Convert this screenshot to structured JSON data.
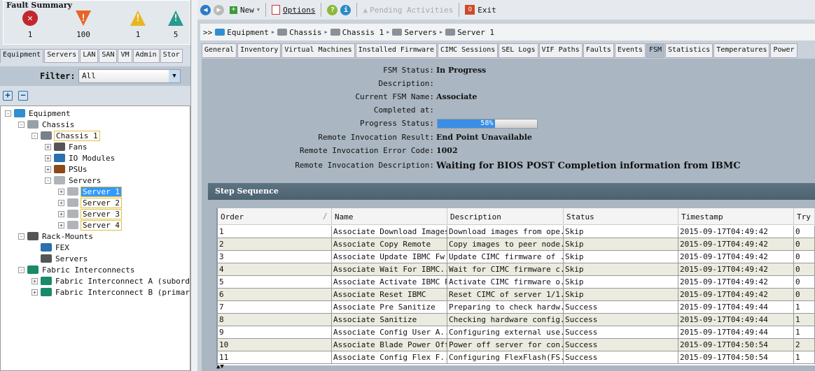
{
  "fault_summary": {
    "title": "Fault Summary",
    "items": [
      {
        "type": "critical",
        "count": "1",
        "color": "#c0282d"
      },
      {
        "type": "major",
        "count": "100",
        "color": "#e8652a"
      },
      {
        "type": "minor",
        "count": "1",
        "color": "#e8b620"
      },
      {
        "type": "warning",
        "count": "5",
        "color": "#2a9a8a"
      }
    ]
  },
  "left_tabs": [
    "Equipment",
    "Servers",
    "LAN",
    "SAN",
    "VM",
    "Admin",
    "Stor"
  ],
  "filter": {
    "label": "Filter:",
    "value": "All"
  },
  "tree": [
    {
      "label": "Equipment",
      "level": 0,
      "exp": "-",
      "icon": "#2f8fd0"
    },
    {
      "label": "Chassis",
      "level": 1,
      "exp": "-",
      "icon": "#9aa0a8"
    },
    {
      "label": "Chassis 1",
      "level": 2,
      "exp": "-",
      "icon": "#7a8088",
      "hl": true
    },
    {
      "label": "Fans",
      "level": 3,
      "exp": "+",
      "icon": "#555"
    },
    {
      "label": "IO Modules",
      "level": 3,
      "exp": "+",
      "icon": "#2a6fb0"
    },
    {
      "label": "PSUs",
      "level": 3,
      "exp": "+",
      "icon": "#8a4a1a"
    },
    {
      "label": "Servers",
      "level": 3,
      "exp": "-",
      "icon": "#b0b4b8"
    },
    {
      "label": "Server 1",
      "level": 4,
      "exp": "+",
      "icon": "#b0b4b8",
      "hl": true,
      "sel": true
    },
    {
      "label": "Server 2",
      "level": 4,
      "exp": "+",
      "icon": "#b0b4b8",
      "hl": true
    },
    {
      "label": "Server 3",
      "level": 4,
      "exp": "+",
      "icon": "#b0b4b8",
      "hl": true
    },
    {
      "label": "Server 4",
      "level": 4,
      "exp": "+",
      "icon": "#b0b4b8",
      "hl": true
    },
    {
      "label": "Rack-Mounts",
      "level": 1,
      "exp": "-",
      "icon": "#555"
    },
    {
      "label": "FEX",
      "level": 2,
      "exp": "",
      "icon": "#2a6fb0"
    },
    {
      "label": "Servers",
      "level": 2,
      "exp": "",
      "icon": "#555"
    },
    {
      "label": "Fabric Interconnects",
      "level": 1,
      "exp": "-",
      "icon": "#1a8a6a"
    },
    {
      "label": "Fabric Interconnect A (subordinate)",
      "level": 2,
      "exp": "+",
      "icon": "#1a8a6a"
    },
    {
      "label": "Fabric Interconnect B (primary)",
      "level": 2,
      "exp": "+",
      "icon": "#1a8a6a"
    }
  ],
  "toolbar": {
    "new": "New",
    "options": "Options",
    "pending": "Pending Activities",
    "exit": "Exit"
  },
  "breadcrumb": [
    "Equipment",
    "Chassis",
    "Chassis 1",
    "Servers",
    "Server 1"
  ],
  "tabs": [
    "General",
    "Inventory",
    "Virtual Machines",
    "Installed Firmware",
    "CIMC Sessions",
    "SEL Logs",
    "VIF Paths",
    "Faults",
    "Events",
    "FSM",
    "Statistics",
    "Temperatures",
    "Power"
  ],
  "active_tab": "FSM",
  "fsm": {
    "fields": [
      {
        "label": "FSM Status:",
        "value": "In Progress"
      },
      {
        "label": "Description:",
        "value": ""
      },
      {
        "label": "Current FSM Name:",
        "value": "Associate"
      },
      {
        "label": "Completed at:",
        "value": ""
      },
      {
        "label": "Progress Status:",
        "value": "58%"
      },
      {
        "label": "Remote Invocation Result:",
        "value": "End Point Unavailable"
      },
      {
        "label": "Remote Invocation Error Code:",
        "value": "1002"
      },
      {
        "label": "Remote Invocation Description:",
        "value": "Waiting for BIOS POST Completion information from IBMC"
      }
    ],
    "progress_percent": 58
  },
  "step_sequence": {
    "title": "Step Sequence",
    "columns": [
      "Order",
      "Name",
      "Description",
      "Status",
      "Timestamp",
      "Try"
    ],
    "rows": [
      [
        "1",
        "Associate Download Images",
        "Download images from ope...",
        "Skip",
        "2015-09-17T04:49:42",
        "0"
      ],
      [
        "2",
        "Associate Copy Remote",
        "Copy images to peer node...",
        "Skip",
        "2015-09-17T04:49:42",
        "0"
      ],
      [
        "3",
        "Associate Update IBMC Fw",
        "Update CIMC firmware of ...",
        "Skip",
        "2015-09-17T04:49:42",
        "0"
      ],
      [
        "4",
        "Associate Wait For IBMC...",
        "Wait for CIMC firmware c...",
        "Skip",
        "2015-09-17T04:49:42",
        "0"
      ],
      [
        "5",
        "Associate Activate IBMC Fw",
        "Activate CIMC firmware o...",
        "Skip",
        "2015-09-17T04:49:42",
        "0"
      ],
      [
        "6",
        "Associate Reset IBMC",
        "Reset CIMC of server 1/1...",
        "Skip",
        "2015-09-17T04:49:42",
        "0"
      ],
      [
        "7",
        "Associate Pre Sanitize",
        "Preparing to check hardw...",
        "Success",
        "2015-09-17T04:49:44",
        "1"
      ],
      [
        "8",
        "Associate Sanitize",
        "Checking hardware config...",
        "Success",
        "2015-09-17T04:49:44",
        "1"
      ],
      [
        "9",
        "Associate Config User A...",
        "Configuring external use...",
        "Success",
        "2015-09-17T04:49:44",
        "1"
      ],
      [
        "10",
        "Associate Blade Power Off",
        "Power off server for con...",
        "Success",
        "2015-09-17T04:50:54",
        "2"
      ],
      [
        "11",
        "Associate Config Flex F...",
        "Configuring FlexFlash(FS...",
        "Success",
        "2015-09-17T04:50:54",
        "1"
      ]
    ]
  }
}
